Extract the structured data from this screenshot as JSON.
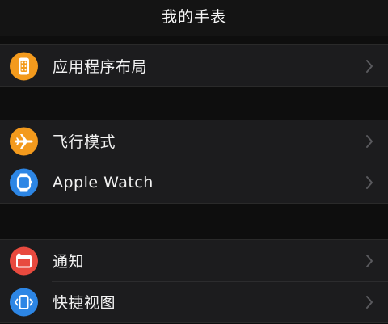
{
  "header": {
    "title": "我的手表"
  },
  "groups": [
    {
      "items": [
        {
          "label": "应用程序布局",
          "icon": "app-layout-icon",
          "color": "#f39a1d"
        }
      ]
    },
    {
      "items": [
        {
          "label": "飞行模式",
          "icon": "airplane-icon",
          "color": "#f39a1d"
        },
        {
          "label": "Apple Watch",
          "icon": "watch-icon",
          "color": "#2d86e5"
        }
      ]
    },
    {
      "items": [
        {
          "label": "通知",
          "icon": "notification-icon",
          "color": "#e84a3f"
        },
        {
          "label": "快捷视图",
          "icon": "glances-icon",
          "color": "#2d86e5"
        }
      ]
    }
  ]
}
